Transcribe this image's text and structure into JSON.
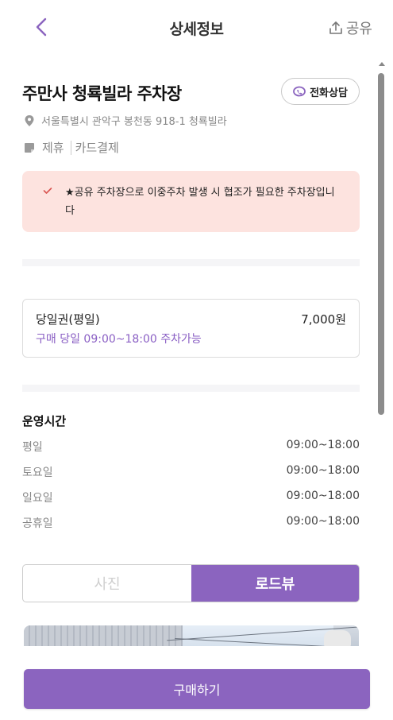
{
  "header": {
    "title": "상세정보",
    "share_label": "공유"
  },
  "lot": {
    "name": "주만사 청룍빌라 주차장",
    "call_label": "전화상담",
    "address": "서울특별시 관악구 봉천동 918-1 청룍빌라",
    "tags": [
      "제휴",
      "카드결제"
    ]
  },
  "notice": {
    "text": "★공유 주차장으로 이중주차 발생 시 협조가 필요한 주차장입니다"
  },
  "ticket": {
    "name": "당일권(평일)",
    "price": "7,000원",
    "description": "구매 당일 09:00~18:00 주차가능"
  },
  "hours": {
    "title": "운영시간",
    "rows": [
      {
        "day": "평일",
        "time": "09:00~18:00"
      },
      {
        "day": "토요일",
        "time": "09:00~18:00"
      },
      {
        "day": "일요일",
        "time": "09:00~18:00"
      },
      {
        "day": "공휴일",
        "time": "09:00~18:00"
      }
    ]
  },
  "view_toggle": {
    "photo_label": "사진",
    "roadview_label": "로드뷰",
    "selected": "로드뷰"
  },
  "footer": {
    "buy_label": "구매하기"
  },
  "colors": {
    "accent": "#8b64bf",
    "notice_bg": "#fde3df",
    "notice_check": "#d9534f"
  },
  "icons": {
    "back": "chevron-left-icon",
    "share": "share-upload-icon",
    "call": "phone-chat-icon",
    "location": "map-pin-icon",
    "tag": "note-icon",
    "check": "check-icon"
  }
}
